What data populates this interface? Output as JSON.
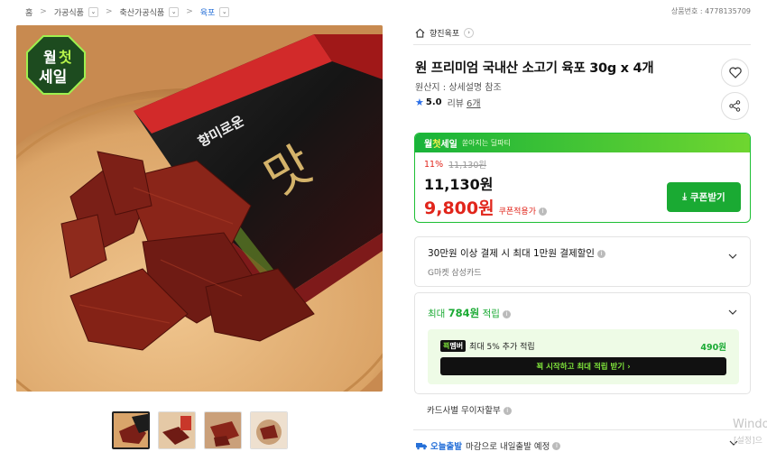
{
  "breadcrumb": [
    {
      "label": "홈",
      "has_dropdown": false
    },
    {
      "label": "가공식품",
      "has_dropdown": true
    },
    {
      "label": "축산가공식품",
      "has_dropdown": true
    },
    {
      "label": "육포",
      "has_dropdown": true
    }
  ],
  "product_no": "상품번호 : 4778135709",
  "image": {
    "badge_line1_a": "월",
    "badge_line1_b": "첫",
    "badge_line2": "세일",
    "package_text": "향미로운"
  },
  "thumbnails_count": 4,
  "seller": {
    "name": "향진육포"
  },
  "title": "원 프리미엄 국내산 소고기 육포 30g x 4개",
  "origin": "원산지 : 상세설명 참조",
  "rating": {
    "score": "5.0",
    "review_label": "리뷰",
    "review_count": "6개"
  },
  "deal": {
    "label_a": "월",
    "label_b": "첫",
    "label_c": "세일",
    "sub": "쏟아지는 딜파티",
    "discount": "11%",
    "original_price": "11,130원",
    "price": "11,130원",
    "coupon_price": "9,800원",
    "coupon_note": "쿠폰적용가",
    "coupon_button": "쿠폰받기"
  },
  "benefit": {
    "title": "30만원 이상 결제 시 최대 1만원 결제할인",
    "card": "G마켓 삼성카드"
  },
  "points": {
    "prefix": "최대",
    "amount": "784원",
    "suffix": "적립",
    "member_badge_a": "꾁",
    "member_badge_b": "멤버",
    "member_text": "최대 5% 추가 적립",
    "member_amount": "490원",
    "cta": "꾁 시작하고 최대 적립 받기 ›"
  },
  "card_installment": "카드사별 무이자할부",
  "delivery": {
    "label": "오늘출발",
    "text": "마감으로 내일출발 예정"
  },
  "watermark": {
    "line1": "Windo",
    "line2": "[설정]으"
  },
  "colors": {
    "green": "#1aaa33",
    "red": "#e1251b",
    "blue": "#2670d8"
  }
}
